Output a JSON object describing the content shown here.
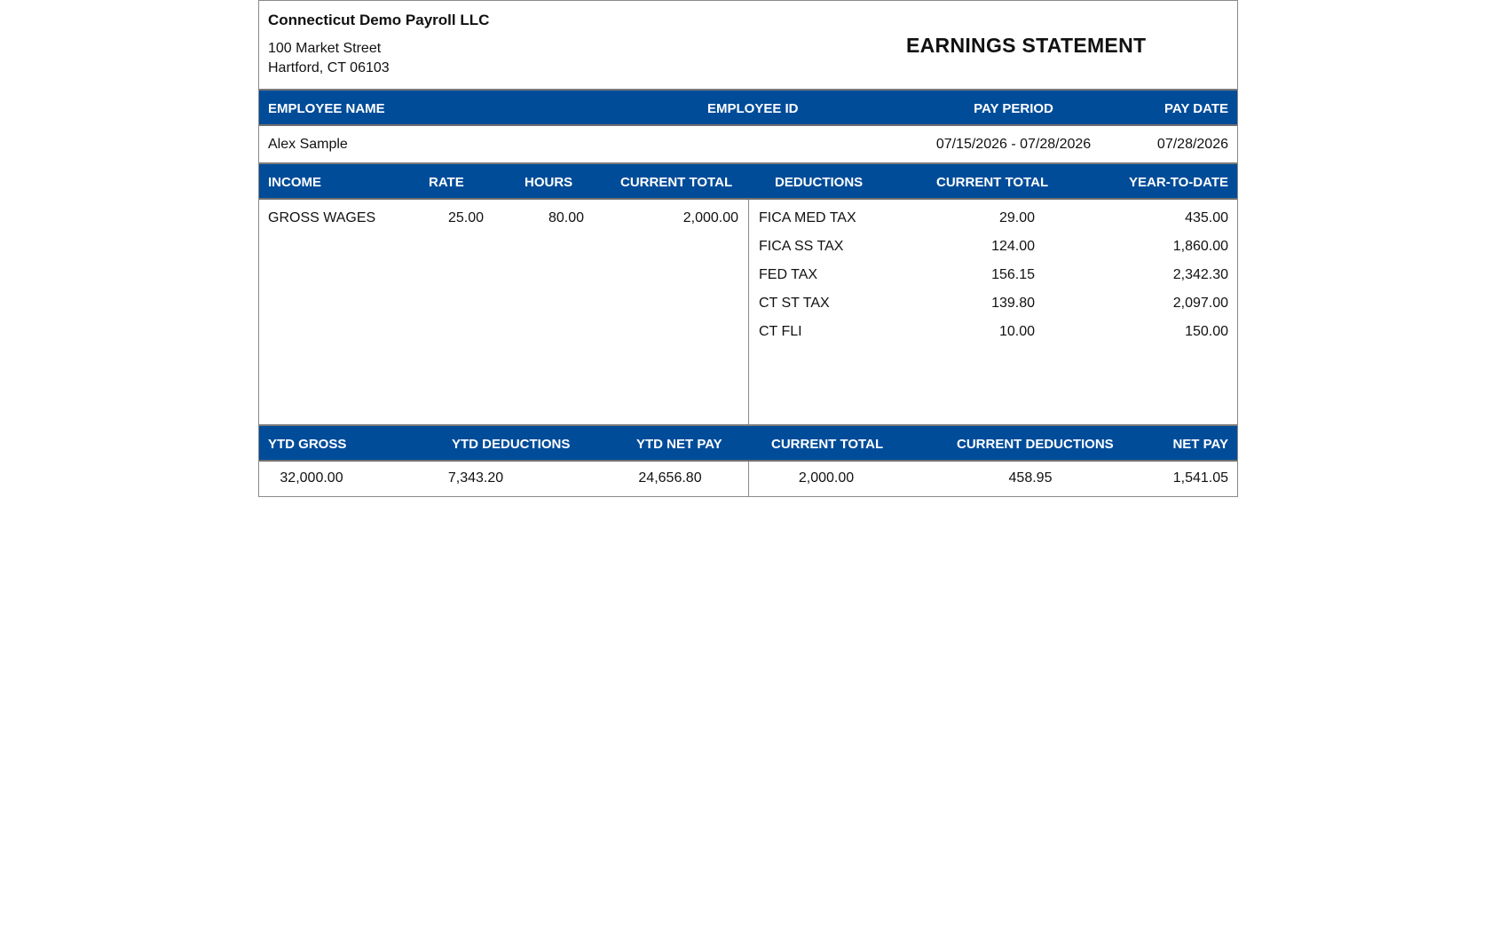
{
  "company": {
    "name": "Connecticut Demo Payroll LLC",
    "address_line1": "100 Market Street",
    "address_line2": "Hartford, CT 06103"
  },
  "title": "EARNINGS STATEMENT",
  "employee_header": {
    "name_label": "EMPLOYEE NAME",
    "id_label": "EMPLOYEE ID",
    "period_label": "PAY PERIOD",
    "date_label": "PAY DATE"
  },
  "employee": {
    "name": "Alex Sample",
    "id": "",
    "pay_period": "07/15/2026 - 07/28/2026",
    "pay_date": "07/28/2026"
  },
  "detail_header": {
    "income": "INCOME",
    "rate": "RATE",
    "hours": "HOURS",
    "income_current_total": "CURRENT TOTAL",
    "deductions": "DEDUCTIONS",
    "deduction_current_total": "CURRENT TOTAL",
    "ytd": "YEAR-TO-DATE"
  },
  "income": [
    {
      "name": "GROSS WAGES",
      "rate": "25.00",
      "hours": "80.00",
      "current_total": "2,000.00"
    }
  ],
  "deductions": [
    {
      "name": "FICA MED TAX",
      "current_total": "29.00",
      "ytd": "435.00"
    },
    {
      "name": "FICA SS TAX",
      "current_total": "124.00",
      "ytd": "1,860.00"
    },
    {
      "name": "FED TAX",
      "current_total": "156.15",
      "ytd": "2,342.30"
    },
    {
      "name": "CT ST TAX",
      "current_total": "139.80",
      "ytd": "2,097.00"
    },
    {
      "name": "CT FLI",
      "current_total": "10.00",
      "ytd": "150.00"
    }
  ],
  "summary_header": {
    "ytd_gross": "YTD GROSS",
    "ytd_deductions": "YTD DEDUCTIONS",
    "ytd_net_pay": "YTD NET PAY",
    "current_total": "CURRENT TOTAL",
    "current_deductions": "CURRENT DEDUCTIONS",
    "net_pay": "NET PAY"
  },
  "summary": {
    "ytd_gross": "32,000.00",
    "ytd_deductions": "7,343.20",
    "ytd_net_pay": "24,656.80",
    "current_total": "2,000.00",
    "current_deductions": "458.95",
    "net_pay": "1,541.05"
  },
  "colors": {
    "header_bar": "#004c99",
    "border": "#8a8a8a"
  }
}
